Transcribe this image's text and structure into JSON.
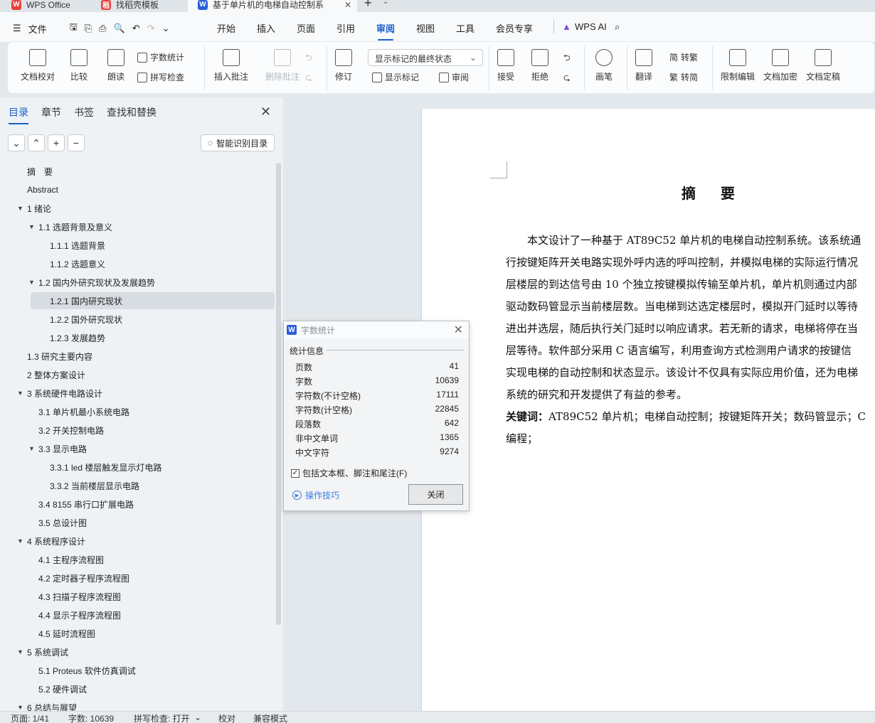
{
  "tabs": [
    {
      "label": "WPS Office",
      "logo": "W",
      "color": "#e8413c"
    },
    {
      "label": "找稻壳模板",
      "logo": "稻",
      "color": "#e8413c"
    },
    {
      "label": "基于单片机的电梯自动控制系",
      "logo": "W",
      "color": "#2b5fd9"
    }
  ],
  "new_tab": "+",
  "menu": {
    "file": "文件",
    "items": [
      "开始",
      "插入",
      "页面",
      "引用",
      "审阅",
      "视图",
      "工具",
      "会员专享"
    ],
    "active": "审阅",
    "ai": "WPS AI"
  },
  "ribbon": {
    "doc_check": "文档校对",
    "compare": "比较",
    "read_aloud": "朗读",
    "word_count": "字数统计",
    "spell_check": "拼写检查",
    "insert_comment": "插入批注",
    "delete_comment": "删除批注",
    "revise": "修订",
    "markup_state": "显示标记的最终状态",
    "show_markup": "显示标记",
    "review": "审阅",
    "accept": "接受",
    "reject": "拒绝",
    "pen": "画笔",
    "translate": "翻译",
    "to_traditional": "转繁",
    "to_simplified": "转简",
    "restrict_edit": "限制编辑",
    "encrypt": "文档加密",
    "finalize": "文档定稿"
  },
  "nav_panel": {
    "tabs": [
      "目录",
      "章节",
      "书签",
      "查找和替换"
    ],
    "active_tab": "目录",
    "smart_toc": "智能识别目录",
    "toc": [
      {
        "label": "摘　要",
        "level": 1,
        "arrow": ""
      },
      {
        "label": "Abstract",
        "level": 1,
        "arrow": ""
      },
      {
        "label": "1  绪论",
        "level": 1,
        "arrow": "▼"
      },
      {
        "label": "1.1  选题背景及意义",
        "level": 2,
        "arrow": "▼"
      },
      {
        "label": "1.1.1  选题背景",
        "level": 3,
        "arrow": ""
      },
      {
        "label": "1.1.2  选题意义",
        "level": 3,
        "arrow": ""
      },
      {
        "label": "1.2  国内外研究现状及发展趋势",
        "level": 2,
        "arrow": "▼"
      },
      {
        "label": "1.2.1  国内研究现状",
        "level": 3,
        "arrow": "",
        "selected": true
      },
      {
        "label": "1.2.2  国外研究现状",
        "level": 3,
        "arrow": ""
      },
      {
        "label": "1.2.3  发展趋势",
        "level": 3,
        "arrow": ""
      },
      {
        "label": "1.3 研究主要内容",
        "level": 1,
        "arrow": ""
      },
      {
        "label": "2  整体方案设计",
        "level": 1,
        "arrow": ""
      },
      {
        "label": "3  系统硬件电路设计",
        "level": 1,
        "arrow": "▼"
      },
      {
        "label": "3.1  单片机最小系统电路",
        "level": 2,
        "arrow": ""
      },
      {
        "label": "3.2  开关控制电路",
        "level": 2,
        "arrow": ""
      },
      {
        "label": "3.3  显示电路",
        "level": 2,
        "arrow": "▼"
      },
      {
        "label": "3.3.1 led 楼层触发显示灯电路",
        "level": 3,
        "arrow": ""
      },
      {
        "label": "3.3.2  当前楼层显示电路",
        "level": 3,
        "arrow": ""
      },
      {
        "label": "3.4 8155 串行口扩展电路",
        "level": 2,
        "arrow": ""
      },
      {
        "label": "3.5  总设计图",
        "level": 2,
        "arrow": ""
      },
      {
        "label": "4  系统程序设计",
        "level": 1,
        "arrow": "▼"
      },
      {
        "label": "4.1  主程序流程图",
        "level": 2,
        "arrow": ""
      },
      {
        "label": "4.2  定时器子程序流程图",
        "level": 2,
        "arrow": ""
      },
      {
        "label": "4.3  扫描子程序流程图",
        "level": 2,
        "arrow": ""
      },
      {
        "label": "4.4  显示子程序流程图",
        "level": 2,
        "arrow": ""
      },
      {
        "label": "4.5  延时流程图",
        "level": 2,
        "arrow": ""
      },
      {
        "label": "5  系统调试",
        "level": 1,
        "arrow": "▼"
      },
      {
        "label": "5.1 Proteus 软件仿真调试",
        "level": 2,
        "arrow": ""
      },
      {
        "label": "5.2  硬件调试",
        "level": 2,
        "arrow": ""
      },
      {
        "label": "6  总结与展望",
        "level": 1,
        "arrow": "▼"
      }
    ]
  },
  "document": {
    "title": "摘 要",
    "lines": [
      "　　本文设计了一种基于 AT89C52 单片机的电梯自动控制系统。该系统通",
      "行按键矩阵开关电路实现外呼内选的呼叫控制，并模拟电梯的实际运行情况",
      "层楼层的到达信号由 10 个独立按键模拟传输至单片机，单片机则通过内部",
      "驱动数码管显示当前楼层数。当电梯到达选定楼层时，模拟开门延时以等待",
      "进出并选层，随后执行关门延时以响应请求。若无新的请求，电梯将停在当",
      "层等待。软件部分采用 C 语言编写，利用查询方式检测用户请求的按键信",
      "实现电梯的自动控制和状态显示。该设计不仅具有实际应用价值，还为电梯",
      "系统的研究和开发提供了有益的参考。"
    ],
    "keywords_label": "关键词：",
    "keywords": "AT89C52 单片机；电梯自动控制；按键矩阵开关；数码管显示；C",
    "keywords_line2": "编程；"
  },
  "dialog": {
    "title": "字数统计",
    "group": "统计信息",
    "stats": [
      {
        "label": "页数",
        "value": "41"
      },
      {
        "label": "字数",
        "value": "10639"
      },
      {
        "label": "字符数(不计空格)",
        "value": "17111"
      },
      {
        "label": "字符数(计空格)",
        "value": "22845"
      },
      {
        "label": "段落数",
        "value": "642"
      },
      {
        "label": "非中文单词",
        "value": "1365"
      },
      {
        "label": "中文字符",
        "value": "9274"
      }
    ],
    "include_label": "包括文本框、脚注和尾注(F)",
    "include_checked": true,
    "tips": "操作技巧",
    "close": "关闭"
  },
  "statusbar": {
    "page": "页面: 1/41",
    "words": "字数: 10639",
    "spell": "拼写检查: 打开",
    "proof": "校对",
    "compat": "兼容模式"
  }
}
